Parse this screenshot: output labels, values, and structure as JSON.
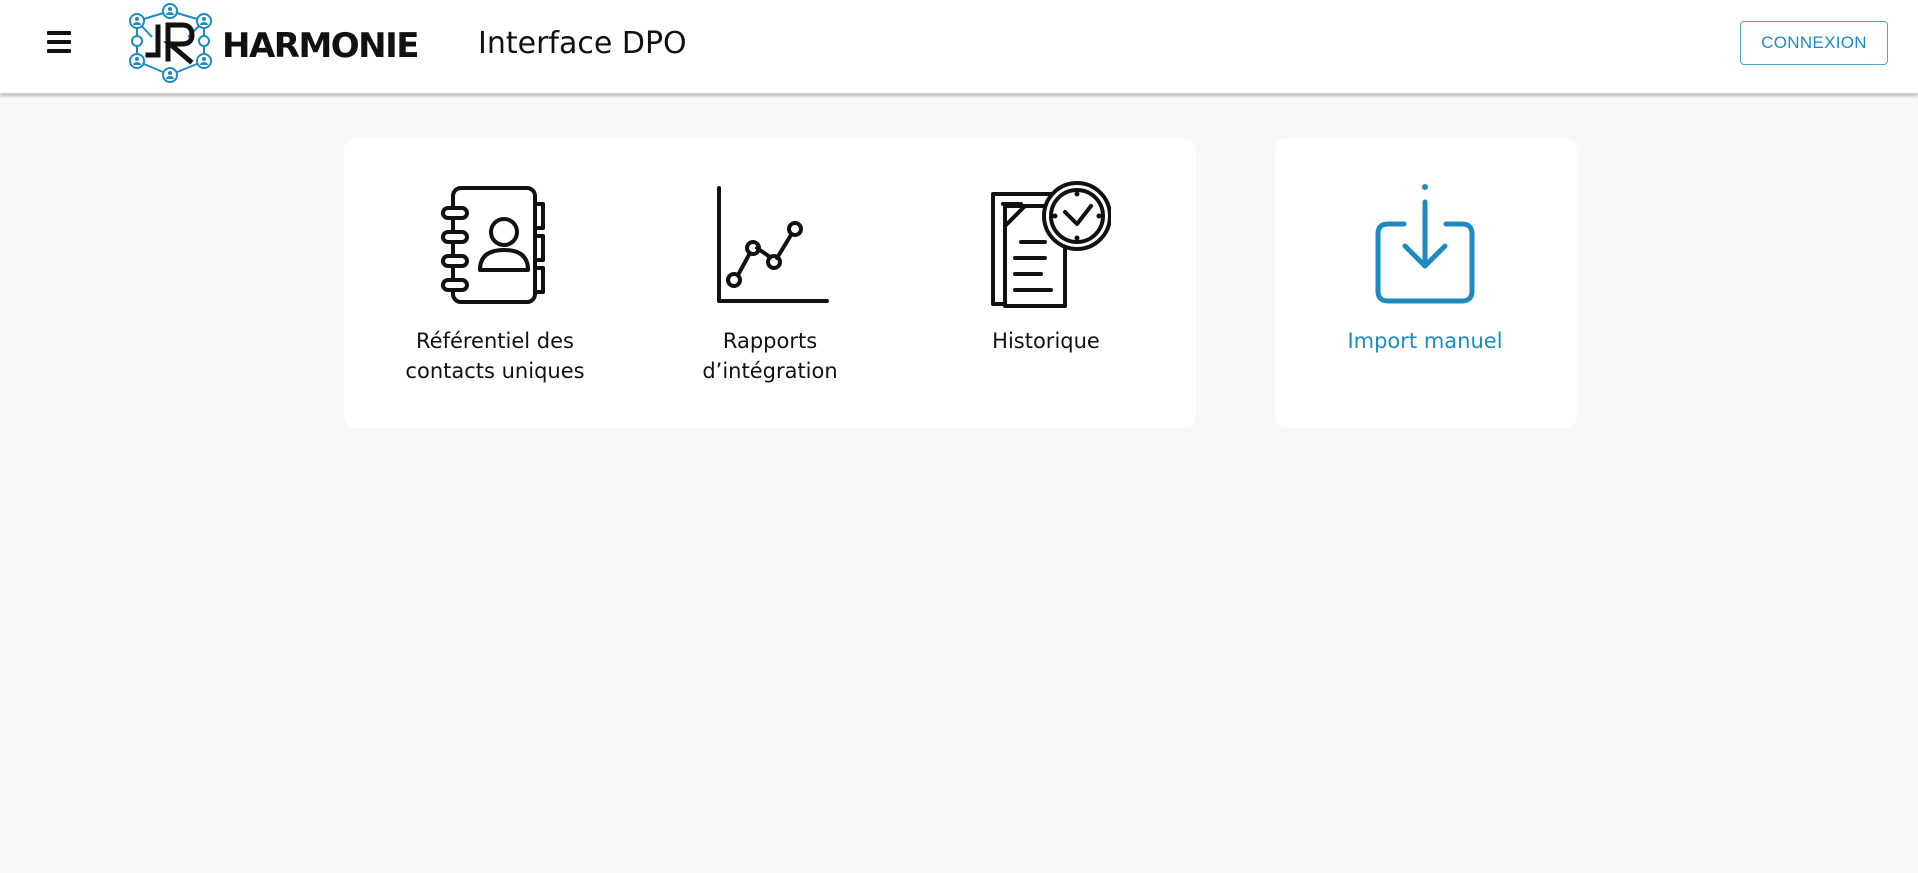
{
  "header": {
    "menu_icon": "hamburger-icon",
    "brand_name": "HARMONIE",
    "page_title": "Interface DPO",
    "login_label": "CONNEXION"
  },
  "tiles": [
    {
      "label_line1": "Référentiel des",
      "label_line2": "contacts uniques",
      "icon": "address-book-icon"
    },
    {
      "label_line1": "Rapports",
      "label_line2": "d’intégration",
      "icon": "line-chart-icon"
    },
    {
      "label_line1": "Historique",
      "label_line2": "",
      "icon": "document-clock-icon"
    }
  ],
  "import_tile": {
    "label": "Import manuel",
    "icon": "download-tray-icon"
  },
  "colors": {
    "accent": "#1d8ac1",
    "background": "#f8f8f8",
    "card": "#ffffff",
    "text": "#111111"
  }
}
